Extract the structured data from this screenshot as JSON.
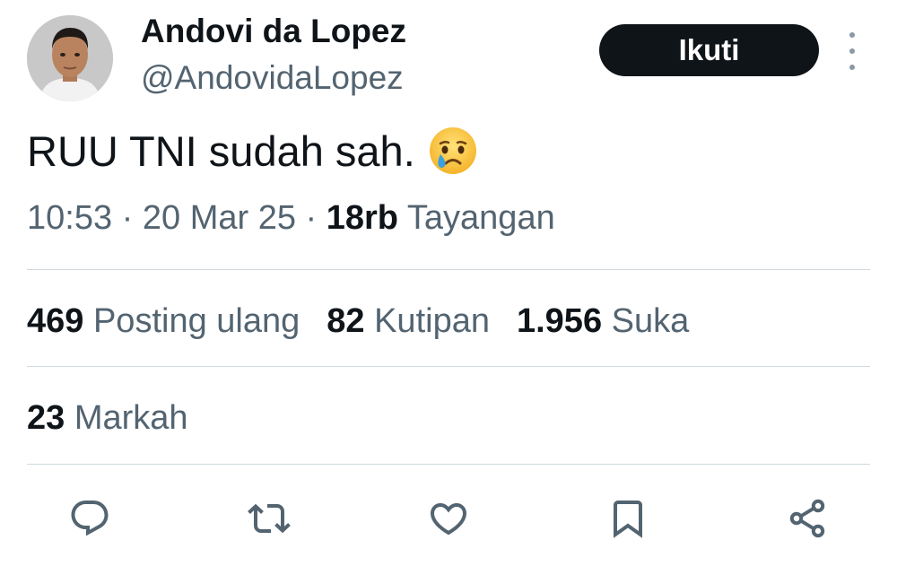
{
  "user": {
    "display_name": "Andovi da Lopez",
    "handle": "@AndovidaLopez"
  },
  "follow_label": "Ikuti",
  "tweet": {
    "text": "RUU TNI sudah sah.",
    "emoji": "crying-face"
  },
  "meta": {
    "time": "10:53",
    "sep1": " · ",
    "date": "20 Mar 25",
    "sep2": " · ",
    "views_count": "18rb",
    "views_label": " Tayangan"
  },
  "stats": {
    "reposts": {
      "count": "469",
      "label": " Posting ulang"
    },
    "quotes": {
      "count": "82",
      "label": " Kutipan"
    },
    "likes": {
      "count": "1.956",
      "label": " Suka"
    },
    "bookmarks": {
      "count": "23",
      "label": " Markah"
    }
  },
  "actions": [
    "reply-icon",
    "retweet-icon",
    "like-icon",
    "bookmark-icon",
    "share-icon"
  ],
  "colors": {
    "text_primary": "#0f1419",
    "text_secondary": "#536471",
    "divider": "#cfd9de",
    "icon": "#536471",
    "button_bg": "#0f1419"
  }
}
